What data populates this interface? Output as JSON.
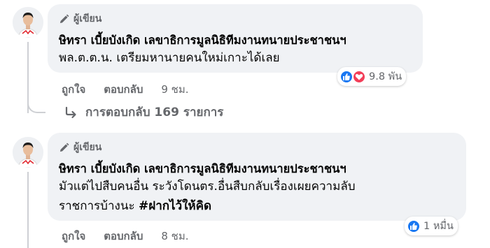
{
  "comments": [
    {
      "badge": "ผู้เขียน",
      "author": "ษิทรา เบี้ยบังเกิด เลขาธิการมูลนิธิทีมงานทนายประชาชนฯ",
      "lines": [
        "พล.ต.ต.น. เตรียมหานายคนใหม่เกาะได้เลย"
      ],
      "hashtag": "",
      "like_label": "ถูกใจ",
      "reply_label": "ตอบกลับ",
      "time": "9 ชม.",
      "reaction_count": "9.8 พัน",
      "reactions": [
        "like-icon",
        "love-icon"
      ]
    },
    {
      "badge": "ผู้เขียน",
      "author": "ษิทรา เบี้ยบังเกิด เลขาธิการมูลนิธิทีมงานทนายประชาชนฯ",
      "lines": [
        "มัวแต่ไปสืบคนอื่น ระวังโดนตร.อื่นสืบกลับเรื่องเผยความลับ",
        "ราชการบ้างนะ "
      ],
      "hashtag": "#ฝากไว้ให้คิด",
      "like_label": "ถูกใจ",
      "reply_label": "ตอบกลับ",
      "time": "8 ชม.",
      "reaction_count": "1 หมื่น",
      "reactions": [
        "like-icon",
        "love-icon"
      ]
    }
  ],
  "replies_link": "การตอบกลับ 169 รายการ",
  "colors": {
    "bubble": "#f0f2f5",
    "secondary_text": "#65676b",
    "like_blue": "#1877f2",
    "love_red": "#f33e58"
  }
}
